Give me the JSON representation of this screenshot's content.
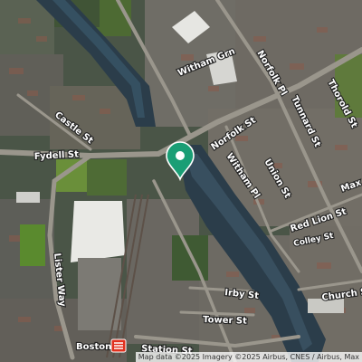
{
  "map": {
    "imagery": "satellite",
    "streets": {
      "witham_grn": "Witham Grn",
      "norfolk_pl": "Norfolk Pl",
      "thorold_st": "Thorold St",
      "tunnard_st": "Tunnard St",
      "castle_st": "Castle St",
      "fydell_st": "Fydell St",
      "norfolk_st": "Norfolk St",
      "union_st": "Union St",
      "witham_pl": "Witham Pl",
      "red_lion_st": "Red Lion St",
      "colley_st": "Colley St",
      "lister_way": "Lister Way",
      "irby_st": "Irby St",
      "church_st": "Church St",
      "tower_st": "Tower St",
      "station_st": "Station St",
      "max_st": "Max"
    },
    "places": {
      "boston_station": "Boston"
    },
    "marker": {
      "icon": "map-pin-icon",
      "color": "#1a9e75"
    },
    "attribution": "Map data ©2025 Imagery ©2025 Airbus, CNES / Airbus, Max"
  }
}
